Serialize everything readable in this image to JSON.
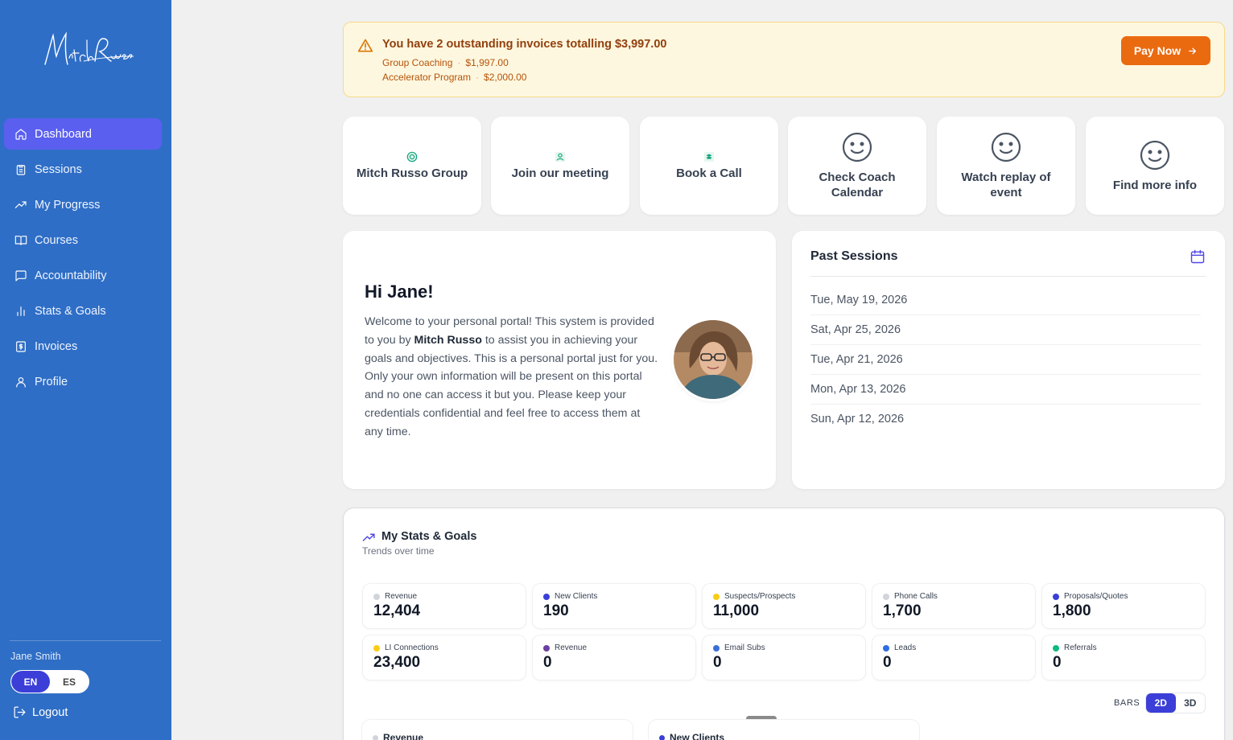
{
  "sidebar": {
    "nav": [
      {
        "label": "Dashboard",
        "icon": "home-icon",
        "active": true
      },
      {
        "label": "Sessions",
        "icon": "clipboard-icon"
      },
      {
        "label": "My Progress",
        "icon": "trending-up-icon"
      },
      {
        "label": "Courses",
        "icon": "book-open-icon"
      },
      {
        "label": "Accountability",
        "icon": "message-square-icon"
      },
      {
        "label": "Stats & Goals",
        "icon": "bar-chart-icon"
      },
      {
        "label": "Invoices",
        "icon": "dollar-receipt-icon"
      },
      {
        "label": "Profile",
        "icon": "user-icon"
      }
    ],
    "user_name": "Jane Smith",
    "lang_en": "EN",
    "lang_es": "ES",
    "logout": "Logout"
  },
  "alert": {
    "title": "You have 2 outstanding invoices totalling $3,997.00",
    "items": [
      {
        "name": "Group Coaching",
        "amount": "$1,997.00"
      },
      {
        "name": "Accelerator Program",
        "amount": "$2,000.00"
      }
    ],
    "separator": "·",
    "pay_label": "Pay Now",
    "colors": {
      "bg": "#fef7df",
      "accent": "#ea6a10"
    }
  },
  "quick_links": [
    {
      "label": "Mitch Russo Group",
      "icon": "group-icon"
    },
    {
      "label": "Join our meeting",
      "icon": "meeting-icon"
    },
    {
      "label": "Book a Call",
      "icon": "phone-icon"
    },
    {
      "label": "Check Coach Calendar",
      "icon": "smile-icon"
    },
    {
      "label": "Watch replay of event",
      "icon": "smile-icon"
    },
    {
      "label": "Find more info",
      "icon": "smile-icon"
    }
  ],
  "welcome": {
    "greeting": "Hi Jane!",
    "text_before": "Welcome to your personal portal! This system is provided to you by ",
    "text_bold": "Mitch Russo",
    "text_after": " to assist you in achieving your goals and objectives. This is a personal portal just for you. Only your own information will be present on this portal and no one can access it but you. Please keep your credentials confidential and feel free to access them at any time."
  },
  "past_sessions": {
    "title": "Past Sessions",
    "dates": [
      "Tue, May 19, 2026",
      "Sat, Apr 25, 2026",
      "Tue, Apr 21, 2026",
      "Mon, Apr 13, 2026",
      "Sun, Apr 12, 2026"
    ]
  },
  "stats": {
    "title": "My Stats & Goals",
    "subtitle": "Trends over time",
    "cards": [
      {
        "label": "Revenue",
        "value": "12,404",
        "color": "#d1d5db"
      },
      {
        "label": "New Clients",
        "value": "190",
        "color": "#3b3fd8"
      },
      {
        "label": "Suspects/Prospects",
        "value": "11,000",
        "color": "#facc15"
      },
      {
        "label": "Phone Calls",
        "value": "1,700",
        "color": "#d1d5db"
      },
      {
        "label": "Proposals/Quotes",
        "value": "1,800",
        "color": "#3b3fd8"
      },
      {
        "label": "LI Connections",
        "value": "23,400",
        "color": "#facc15"
      },
      {
        "label": "Revenue",
        "value": "0",
        "color": "#6b3fa0"
      },
      {
        "label": "Email Subs",
        "value": "0",
        "color": "#3b6fd8"
      },
      {
        "label": "Leads",
        "value": "0",
        "color": "#2f6ee0"
      },
      {
        "label": "Referrals",
        "value": "0",
        "color": "#10b981"
      }
    ],
    "bars_label": "BARS",
    "mode_2d": "2D",
    "mode_3d": "3D",
    "charts": [
      {
        "label": "Revenue",
        "color": "#d1d5db"
      },
      {
        "label": "New Clients",
        "color": "#3b3fd8"
      }
    ]
  }
}
